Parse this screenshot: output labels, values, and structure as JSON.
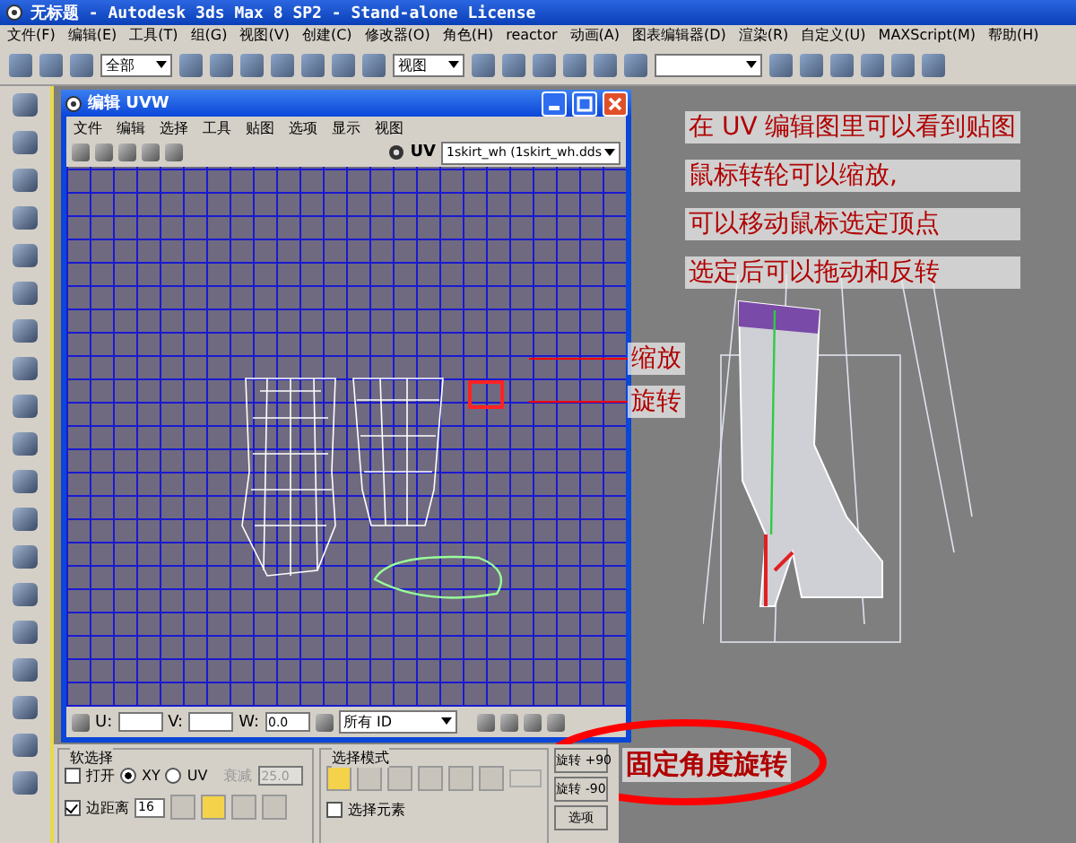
{
  "window": {
    "title": "无标题 - Autodesk 3ds Max 8 SP2  - Stand-alone License"
  },
  "menu": [
    "文件(F)",
    "编辑(E)",
    "工具(T)",
    "组(G)",
    "视图(V)",
    "创建(C)",
    "修改器(O)",
    "角色(H)",
    "reactor",
    "动画(A)",
    "图表编辑器(D)",
    "渲染(R)",
    "自定义(U)",
    "MAXScript(M)",
    "帮助(H)"
  ],
  "toolbar": {
    "selection_filter": "全部",
    "reference_coord": "视图"
  },
  "uv_editor": {
    "title": "编辑 UVW",
    "menu": [
      "文件",
      "编辑",
      "选择",
      "工具",
      "贴图",
      "选项",
      "显示",
      "视图"
    ],
    "map_label": "UV",
    "map_dropdown": "1skirt_wh (1skirt_wh.dds",
    "u_label": "U:",
    "v_label": "V:",
    "w_label": "W:",
    "w_value": "0.0",
    "id_dropdown": "所有 ID"
  },
  "soft_selection": {
    "title": "软选择",
    "open": {
      "label": "打开",
      "checked": false
    },
    "axes": [
      {
        "label": "XY",
        "selected": true
      },
      {
        "label": "UV",
        "selected": false
      }
    ],
    "falloff": {
      "label": "衰减",
      "value": "25.0",
      "disabled": true
    },
    "edge_distance": {
      "label": "边距离",
      "checked": true
    },
    "edge_value": "16"
  },
  "selection_mode": {
    "title": "选择模式",
    "select_element": {
      "label": "选择元素",
      "checked": false
    }
  },
  "rotate_buttons": [
    "旋转 +90",
    "旋转 -90"
  ],
  "options_button": "选项",
  "notes": [
    "在 UV 编辑图里可以看到贴图",
    "鼠标转轮可以缩放,",
    "可以移动鼠标选定顶点",
    "选定后可以拖动和反转"
  ],
  "callouts": [
    "缩放",
    "旋转"
  ],
  "circled_note": "固定角度旋转"
}
